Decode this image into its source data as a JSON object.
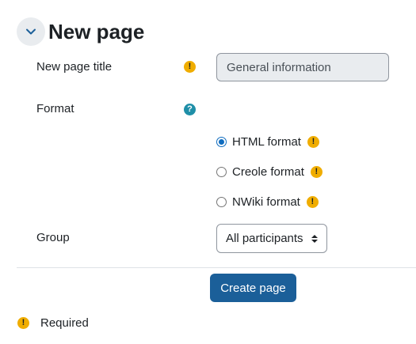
{
  "section": {
    "title": "New page"
  },
  "fields": {
    "page_title": {
      "label": "New page title",
      "value": "General information"
    },
    "format": {
      "label": "Format",
      "options": [
        {
          "label": "HTML format",
          "selected": true
        },
        {
          "label": "Creole format",
          "selected": false
        },
        {
          "label": "NWiki format",
          "selected": false
        }
      ]
    },
    "group": {
      "label": "Group",
      "selected": "All participants"
    }
  },
  "actions": {
    "create_label": "Create page"
  },
  "legend": {
    "required_label": "Required"
  },
  "icons": {
    "required": "exclamation-circle-icon",
    "help": "question-circle-icon",
    "collapse": "chevron-down-icon"
  },
  "colors": {
    "required_icon": "#f0ad00",
    "help_icon": "#1f8fa8",
    "primary_button": "#1b5f99",
    "radio_selected": "#0f6cbf"
  }
}
